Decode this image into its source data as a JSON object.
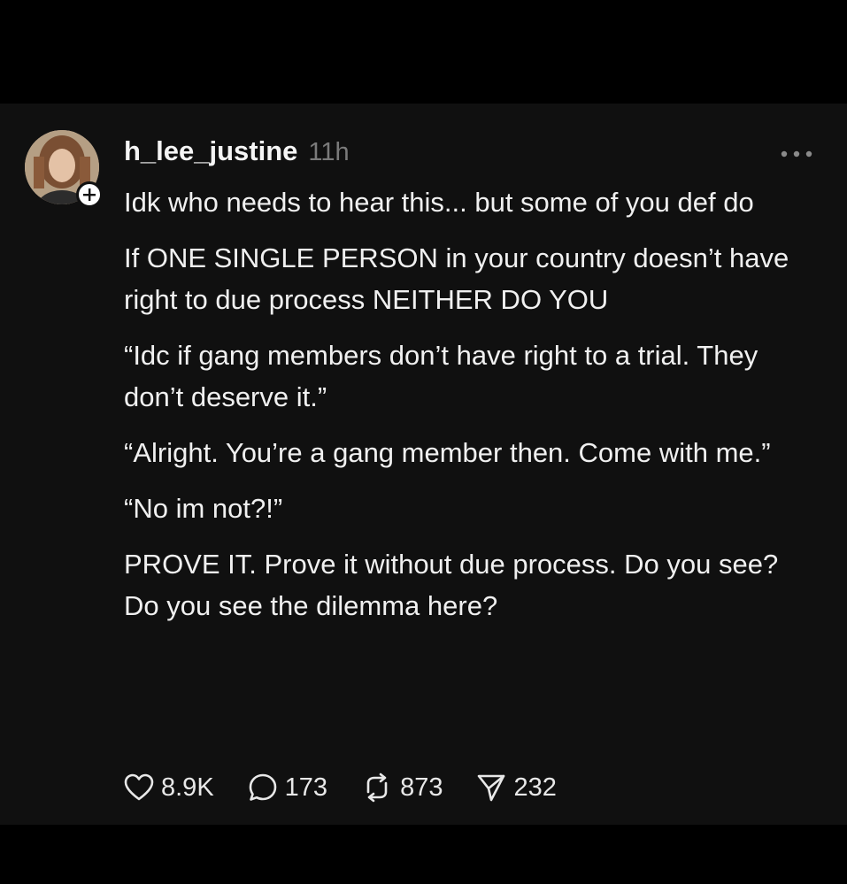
{
  "post": {
    "username": "h_lee_justine",
    "timestamp": "11h",
    "paragraphs": [
      "Idk who needs to hear this... but some of you def do",
      "If ONE SINGLE PERSON in your country doesn’t have right to due process NEITHER DO YOU",
      "“Idc if gang members don’t have right to a trial. They don’t deserve it.”",
      "“Alright. You’re a gang member then. Come with me.”",
      "“No im not?!”",
      "PROVE IT. Prove it without due process. Do you see? Do you see the dilemma here?"
    ]
  },
  "actions": {
    "likes": "8.9K",
    "replies": "173",
    "reposts": "873",
    "shares": "232"
  },
  "icons": {
    "like": "heart-icon",
    "reply": "speech-bubble-icon",
    "repost": "repost-icon",
    "share": "send-icon",
    "more": "more-icon",
    "follow": "plus-icon"
  },
  "colors": {
    "background": "#000000",
    "card": "#101010",
    "text": "#f0f0f0",
    "muted": "#7a7a7a"
  }
}
